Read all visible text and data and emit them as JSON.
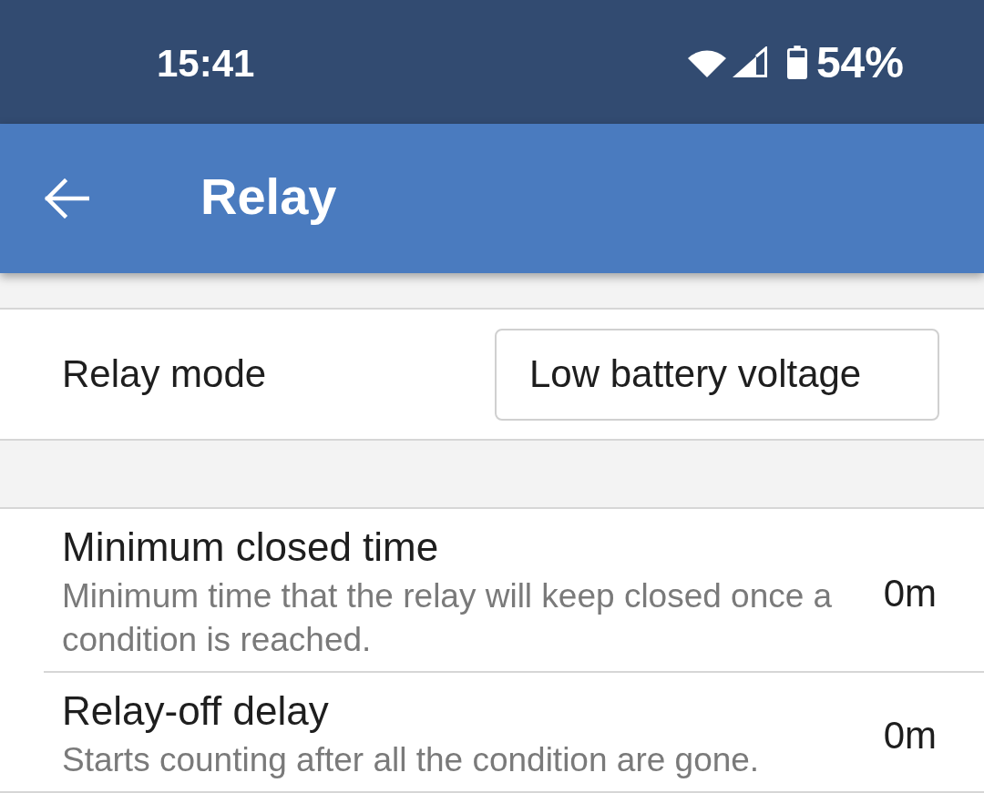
{
  "status_bar": {
    "time": "15:41",
    "battery": "54%"
  },
  "app_bar": {
    "title": "Relay"
  },
  "relay_mode": {
    "label": "Relay mode",
    "value": "Low battery voltage"
  },
  "settings": [
    {
      "title": "Minimum closed time",
      "description": "Minimum time that the relay will keep closed once a condition is reached.",
      "value": "0m"
    },
    {
      "title": "Relay-off delay",
      "description": "Starts counting after all the condition are gone.",
      "value": "0m"
    }
  ]
}
